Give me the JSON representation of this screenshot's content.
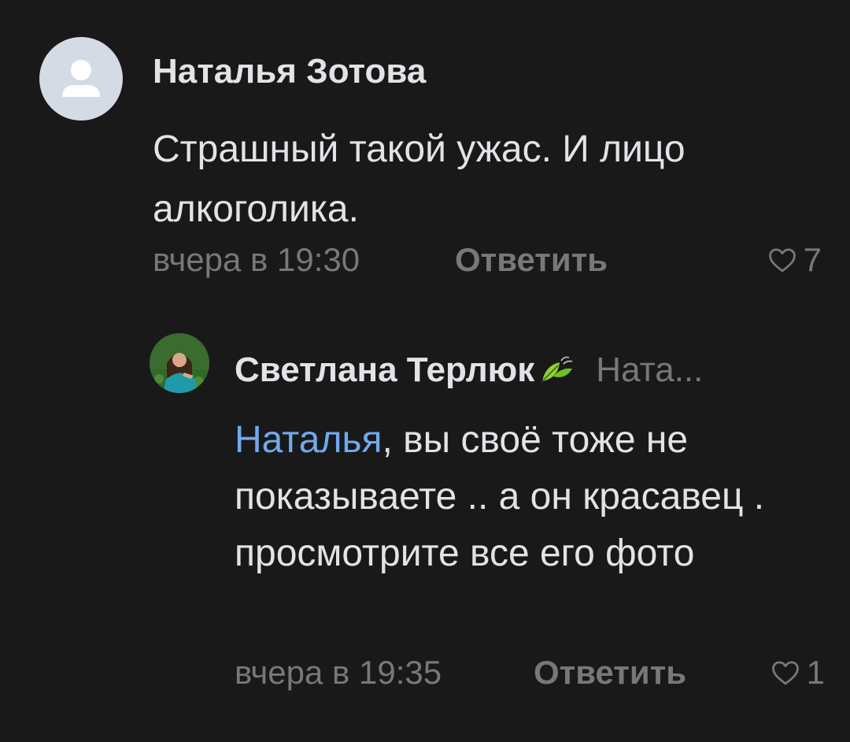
{
  "comments": [
    {
      "author": "Наталья Зотова",
      "text": "Страшный такой ужас. И лицо алкоголика.",
      "time": "вчера в 19:30",
      "reply_label": "Ответить",
      "likes": "7"
    }
  ],
  "reply": {
    "author": "Светлана Терлюк",
    "reply_to": "Ната...",
    "mention": "Наталья",
    "text": ", вы своё тоже не показываете .. а он красавец . просмотрите все его фото",
    "time": "вчера в 19:35",
    "reply_label": "Ответить",
    "likes": "1"
  },
  "colors": {
    "background": "#19191a",
    "text_primary": "#e1e3e6",
    "text_secondary": "#76787a",
    "mention": "#71aaeb",
    "avatar_placeholder": "#d5dbe4"
  },
  "icons": {
    "avatar_placeholder": "user-silhouette-icon",
    "author_badge": "leaf-icon",
    "like": "heart-outline-icon"
  }
}
